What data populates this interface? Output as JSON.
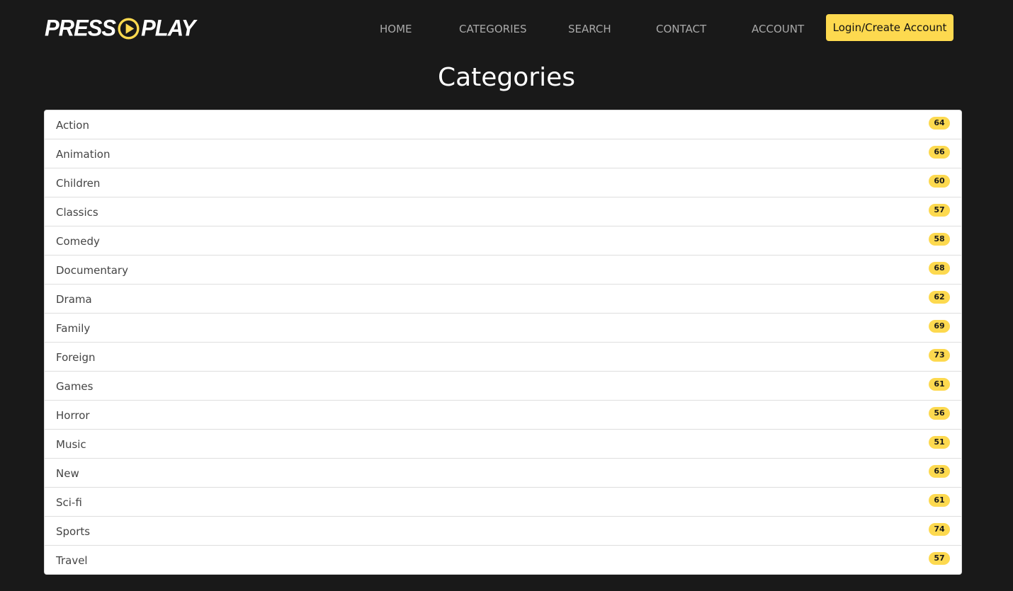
{
  "brand": {
    "word1": "PRESS",
    "word2": "PLAY",
    "logo_icon": "play-circle-icon",
    "accent_color": "#fdd94f"
  },
  "nav": {
    "items": [
      {
        "label": "HOME"
      },
      {
        "label": "CATEGORIES"
      },
      {
        "label": "SEARCH"
      },
      {
        "label": "CONTACT"
      },
      {
        "label": "ACCOUNT"
      }
    ],
    "login_label": "Login/Create Account"
  },
  "page": {
    "title": "Categories"
  },
  "categories": [
    {
      "name": "Action",
      "count": "64"
    },
    {
      "name": "Animation",
      "count": "66"
    },
    {
      "name": "Children",
      "count": "60"
    },
    {
      "name": "Classics",
      "count": "57"
    },
    {
      "name": "Comedy",
      "count": "58"
    },
    {
      "name": "Documentary",
      "count": "68"
    },
    {
      "name": "Drama",
      "count": "62"
    },
    {
      "name": "Family",
      "count": "69"
    },
    {
      "name": "Foreign",
      "count": "73"
    },
    {
      "name": "Games",
      "count": "61"
    },
    {
      "name": "Horror",
      "count": "56"
    },
    {
      "name": "Music",
      "count": "51"
    },
    {
      "name": "New",
      "count": "63"
    },
    {
      "name": "Sci-fi",
      "count": "61"
    },
    {
      "name": "Sports",
      "count": "74"
    },
    {
      "name": "Travel",
      "count": "57"
    }
  ],
  "colors": {
    "background": "#191919",
    "accent": "#fdd94f",
    "nav_text": "#a9a9a9"
  }
}
